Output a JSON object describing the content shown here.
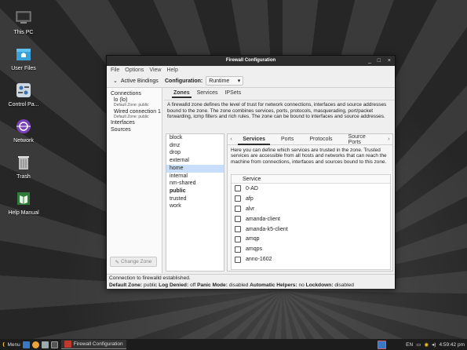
{
  "desktop": {
    "icons": [
      {
        "label": "This PC",
        "icon": "computer-icon"
      },
      {
        "label": "User Files",
        "icon": "folder-icon"
      },
      {
        "label": "Control Pa...",
        "icon": "control-panel-icon"
      },
      {
        "label": "Network",
        "icon": "network-icon"
      },
      {
        "label": "Trash",
        "icon": "trash-icon"
      },
      {
        "label": "Help Manual",
        "icon": "help-manual-icon"
      }
    ]
  },
  "window": {
    "title": "Firewall Configuration",
    "controls": {
      "minimize": "_",
      "maximize": "□",
      "close": "×"
    },
    "menu": [
      "File",
      "Options",
      "View",
      "Help"
    ],
    "toolbar": {
      "active_bindings": "Active Bindings",
      "configuration_label": "Configuration:",
      "configuration_value": "Runtime"
    },
    "left": {
      "connections_header": "Connections",
      "connections": [
        {
          "name": "lo (lo)",
          "zone": "Default Zone: public"
        },
        {
          "name": "Wired connection 1",
          "zone": "Default Zone: public"
        }
      ],
      "interfaces": "Interfaces",
      "sources": "Sources",
      "change_zone": "Change Zone"
    },
    "tabs": [
      "Zones",
      "Services",
      "IPSets"
    ],
    "zone_description": "A firewalld zone defines the level of trust for network connections, interfaces and source addresses bound to the zone. The zone combines services, ports, protocols, masquerading, port/packet forwarding, icmp filters and rich rules. The zone can be bound to interfaces and source addresses.",
    "zones": [
      "block",
      "dmz",
      "drop",
      "external",
      "home",
      "internal",
      "nm-shared",
      "public",
      "trusted",
      "work"
    ],
    "selected_zone": "home",
    "bold_zone": "public",
    "subtabs": [
      "Services",
      "Ports",
      "Protocols",
      "Source Ports"
    ],
    "services_description": "Here you can define which services are trusted in the zone. Trusted services are accessible from all hosts and networks that can reach the machine from connections, interfaces and sources bound to this zone.",
    "services_header": "Service",
    "services": [
      "0-AD",
      "afp",
      "alvr",
      "amanda-client",
      "amanda-k5-client",
      "amqp",
      "amqps",
      "anno-1602"
    ],
    "status": {
      "line1": "Connection to firewalld established.",
      "default_zone_label": "Default Zone:",
      "default_zone": "public",
      "log_denied_label": "Log Denied:",
      "log_denied": "off",
      "panic_label": "Panic Mode:",
      "panic": "disabled",
      "helpers_label": "Automatic Helpers:",
      "helpers": "no",
      "lockdown_label": "Lockdown:",
      "lockdown": "disabled"
    }
  },
  "taskbar": {
    "menu_label": "Menu",
    "app_label": "Firewall Configuration",
    "lang": "EN",
    "clock": "4:59:42 pm"
  },
  "colors": {
    "selection": "#c9defa",
    "titlebar": "#2d2d2d",
    "taskbar": "#1c1c1c"
  }
}
